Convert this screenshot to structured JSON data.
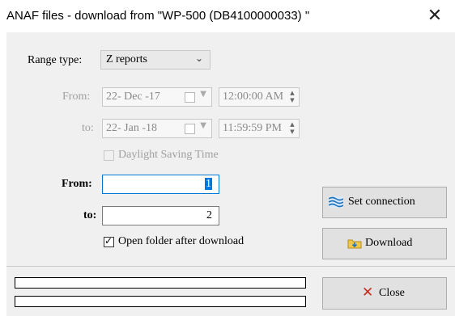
{
  "window": {
    "title": "ANAF files - download from \"WP-500 (DB4100000033) \"",
    "close_glyph": "✕"
  },
  "range": {
    "label": "Range type:",
    "value": "Z reports"
  },
  "date_from": {
    "label": "From:",
    "date": "22- Dec -17",
    "time": "12:00:00 AM"
  },
  "date_to": {
    "label": "to:",
    "date": "22- Jan -18",
    "time": "11:59:59 PM"
  },
  "dst": {
    "label": "Daylight Saving Time",
    "checked": false
  },
  "num_from": {
    "label": "From:",
    "value": "1"
  },
  "num_to": {
    "label": "to:",
    "value": "2"
  },
  "open_folder": {
    "label": "Open folder after download",
    "checked": true
  },
  "buttons": {
    "set_connection": "Set connection",
    "download": "Download",
    "close": "Close"
  },
  "progress": [
    {
      "value": 0
    },
    {
      "value": 0
    }
  ],
  "colors": {
    "focus": "#0078d7",
    "close_x": "#c42b1c",
    "accent_blue": "#1e73be"
  }
}
